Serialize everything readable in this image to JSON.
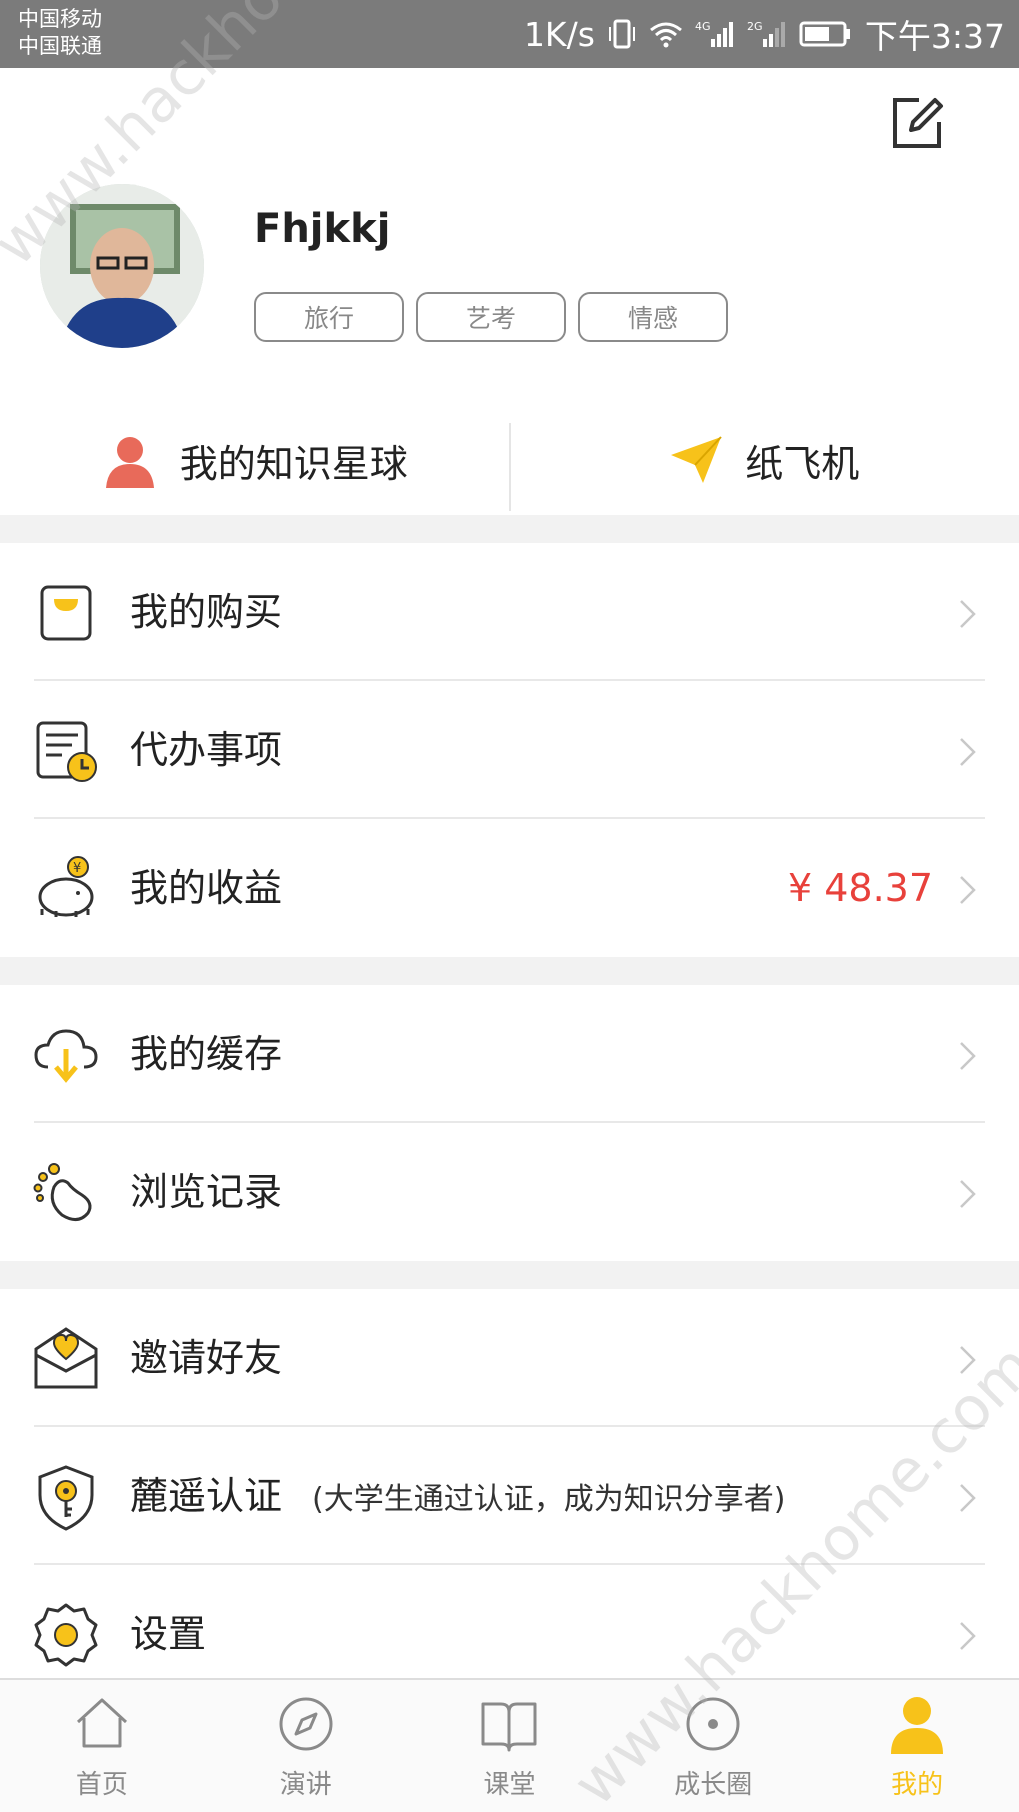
{
  "status_bar": {
    "carrier_1": "中国移动",
    "carrier_2": "中国联通",
    "speed": "1K/s",
    "time": "下午3:37"
  },
  "profile": {
    "username": "Fhjkkj",
    "tags": [
      "旅行",
      "艺考",
      "情感"
    ]
  },
  "quick_links": {
    "planet": "我的知识星球",
    "paper_plane": "纸飞机"
  },
  "menu": {
    "purchases": "我的购买",
    "todo": "代办事项",
    "earnings": "我的收益",
    "earnings_value": "¥ 48.37",
    "cache": "我的缓存",
    "history": "浏览记录",
    "invite": "邀请好友",
    "verify": "麓遥认证",
    "verify_note": "(大学生通过认证，成为知识分享者)",
    "settings": "设置"
  },
  "tabs": [
    "首页",
    "演讲",
    "课堂",
    "成长圈",
    "我的"
  ],
  "active_tab": "我的",
  "watermark": "www.hackhome.com",
  "colors": {
    "accent": "#f7c21a",
    "price": "#e8413b",
    "planet_icon": "#e86a5a"
  }
}
